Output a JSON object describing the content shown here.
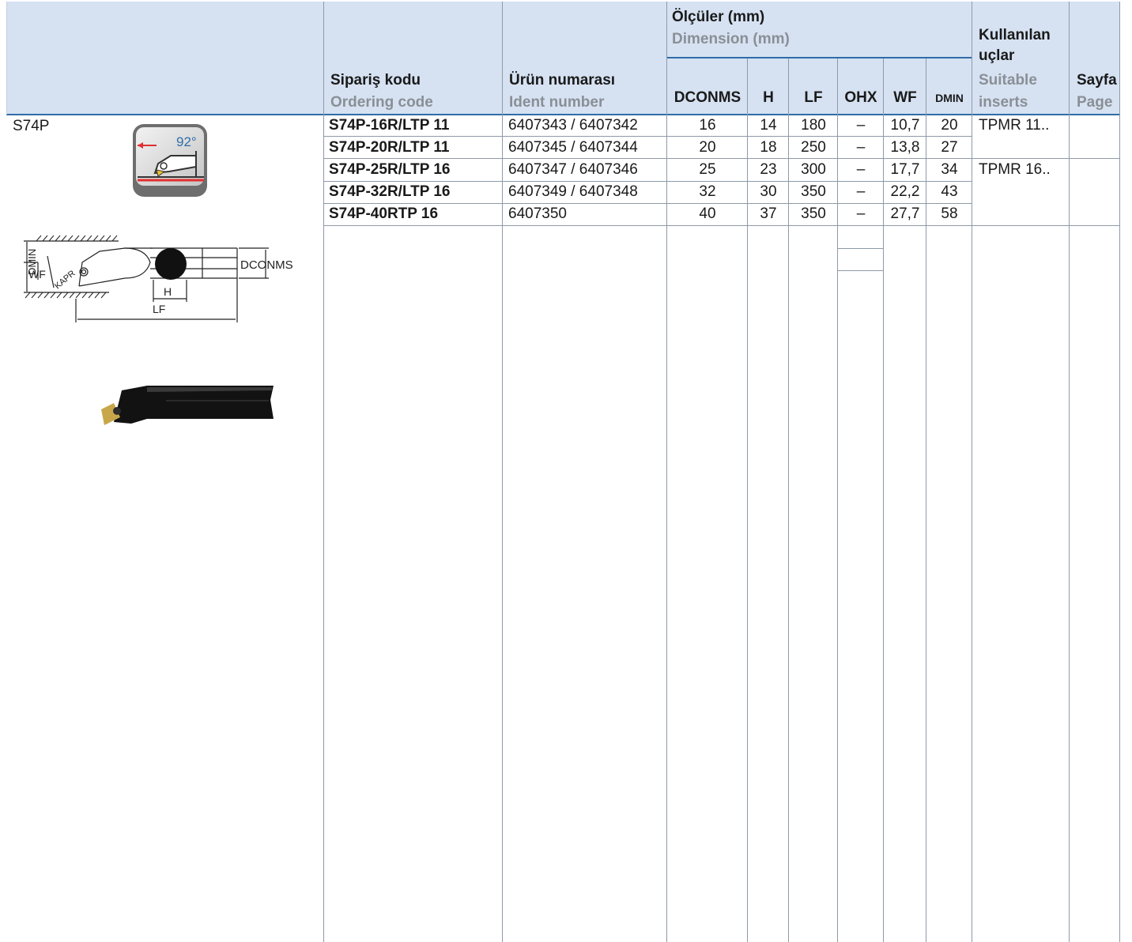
{
  "header": {
    "ordering_tr": "Sipariş kodu",
    "ordering_en": "Ordering code",
    "ident_tr": "Ürün numarası",
    "ident_en": "Ident number",
    "dims_tr": "Ölçüler (mm)",
    "dims_en": "Dimension (mm)",
    "dim_cols": [
      "DCONMS",
      "H",
      "LF",
      "OHX",
      "WF",
      "DMIN"
    ],
    "inserts_tr": "Kullanılan uçlar",
    "inserts_en": "Suitable inserts",
    "page_tr": "Sayfa",
    "page_en": "Page"
  },
  "section": {
    "title": "S74P",
    "icon_angle": "92°",
    "drawing_labels": {
      "dmin": "DMIN",
      "wf": "WF",
      "kapr": "KAPR",
      "h": "H",
      "lf": "LF",
      "dconms": "DCONMS"
    }
  },
  "rows": [
    {
      "code": "S74P-16R/LTP 11",
      "ident": "6407343 / 6407342",
      "dconms": "16",
      "h": "14",
      "lf": "180",
      "ohx": "–",
      "wf": "10,7",
      "dmin": "20",
      "insert": "TPMR 11.."
    },
    {
      "code": "S74P-20R/LTP 11",
      "ident": "6407345 / 6407344",
      "dconms": "20",
      "h": "18",
      "lf": "250",
      "ohx": "–",
      "wf": "13,8",
      "dmin": "27",
      "insert": ""
    },
    {
      "code": "S74P-25R/LTP 16",
      "ident": "6407347 / 6407346",
      "dconms": "25",
      "h": "23",
      "lf": "300",
      "ohx": "–",
      "wf": "17,7",
      "dmin": "34",
      "insert": "TPMR 16.."
    },
    {
      "code": "S74P-32R/LTP 16",
      "ident": "6407349 / 6407348",
      "dconms": "32",
      "h": "30",
      "lf": "350",
      "ohx": "–",
      "wf": "22,2",
      "dmin": "43",
      "insert": ""
    },
    {
      "code": "S74P-40RTP 16",
      "ident": "6407350",
      "dconms": "40",
      "h": "37",
      "lf": "350",
      "ohx": "–",
      "wf": "27,7",
      "dmin": "58",
      "insert": ""
    }
  ],
  "colors": {
    "header_bg": "#d6e2f2",
    "rule_blue": "#2f6da8",
    "arrow_red": "#e03030",
    "insert_gold": "#c8a64a"
  }
}
